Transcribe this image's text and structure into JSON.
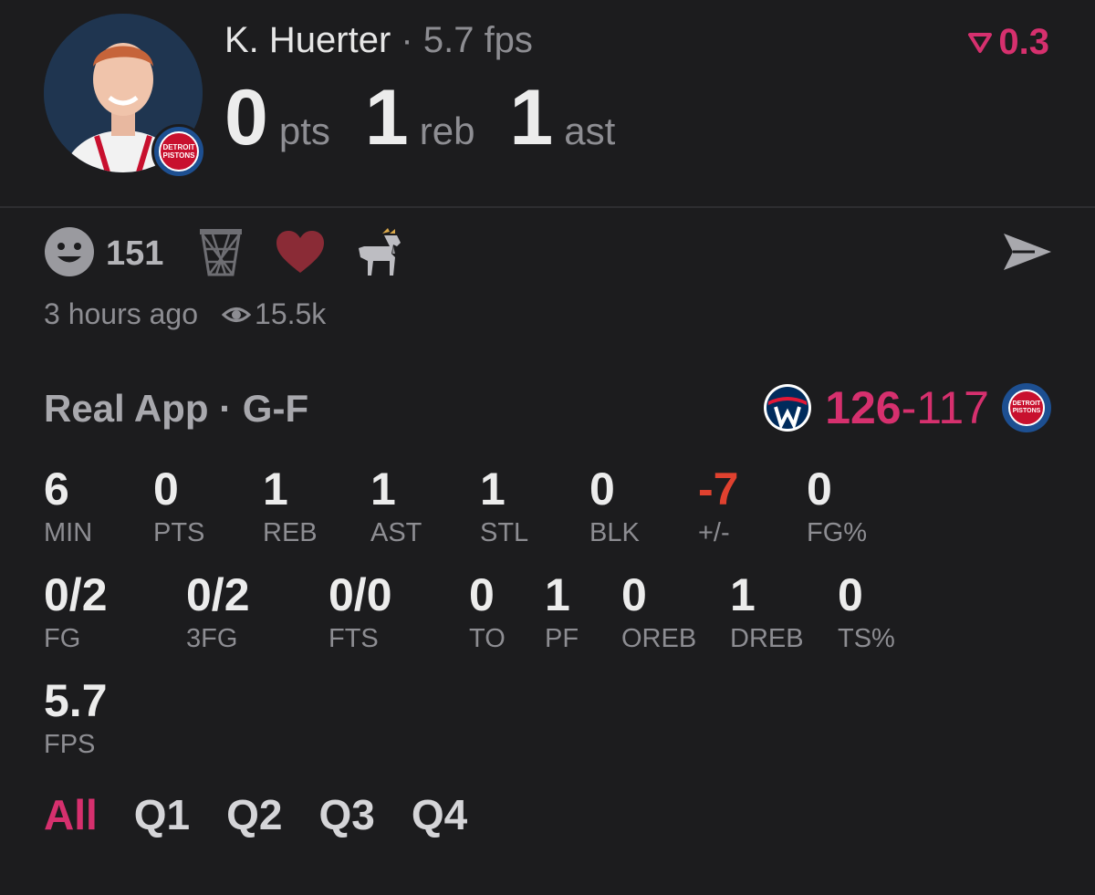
{
  "header": {
    "player_name": "K. Huerter",
    "separator": " · ",
    "fps_label": "5.7 fps",
    "trend_value": "0.3",
    "team_logo_text": "DETROIT PISTONS",
    "headline": [
      {
        "value": "0",
        "unit": "pts"
      },
      {
        "value": "1",
        "unit": "reb"
      },
      {
        "value": "1",
        "unit": "ast"
      }
    ]
  },
  "reactions": {
    "smile_count": "151",
    "icons": [
      "smile-icon",
      "basketball-net-icon",
      "heart-icon",
      "goat-icon",
      "send-icon"
    ]
  },
  "meta": {
    "time_ago": "3 hours ago",
    "views": "15.5k"
  },
  "game": {
    "source_label": "Real App · G-F",
    "score_winner": "126",
    "score_sep": "-",
    "score_loser": "117",
    "away_team": "Washington Wizards",
    "home_logo_text": "DETROIT PISTONS"
  },
  "stats_row1": [
    {
      "value": "6",
      "label": "MIN"
    },
    {
      "value": "0",
      "label": "PTS"
    },
    {
      "value": "1",
      "label": "REB"
    },
    {
      "value": "1",
      "label": "AST"
    },
    {
      "value": "1",
      "label": "STL"
    },
    {
      "value": "0",
      "label": "BLK"
    },
    {
      "value": "-7",
      "label": "+/-"
    },
    {
      "value": "0",
      "label": "FG%"
    }
  ],
  "stats_row2": [
    {
      "value": "0/2",
      "label": "FG"
    },
    {
      "value": "0/2",
      "label": "3FG"
    },
    {
      "value": "0/0",
      "label": "FTS"
    },
    {
      "value": "0",
      "label": "TO"
    },
    {
      "value": "1",
      "label": "PF"
    },
    {
      "value": "0",
      "label": "OREB"
    },
    {
      "value": "1",
      "label": "DREB"
    },
    {
      "value": "0",
      "label": "TS%"
    }
  ],
  "stats_row3": [
    {
      "value": "5.7",
      "label": "FPS"
    }
  ],
  "tabs": [
    "All",
    "Q1",
    "Q2",
    "Q3",
    "Q4"
  ],
  "colors": {
    "accent": "#d6306e",
    "negative": "#e0412f",
    "background": "#1c1c1e",
    "muted": "#8d8d92"
  }
}
